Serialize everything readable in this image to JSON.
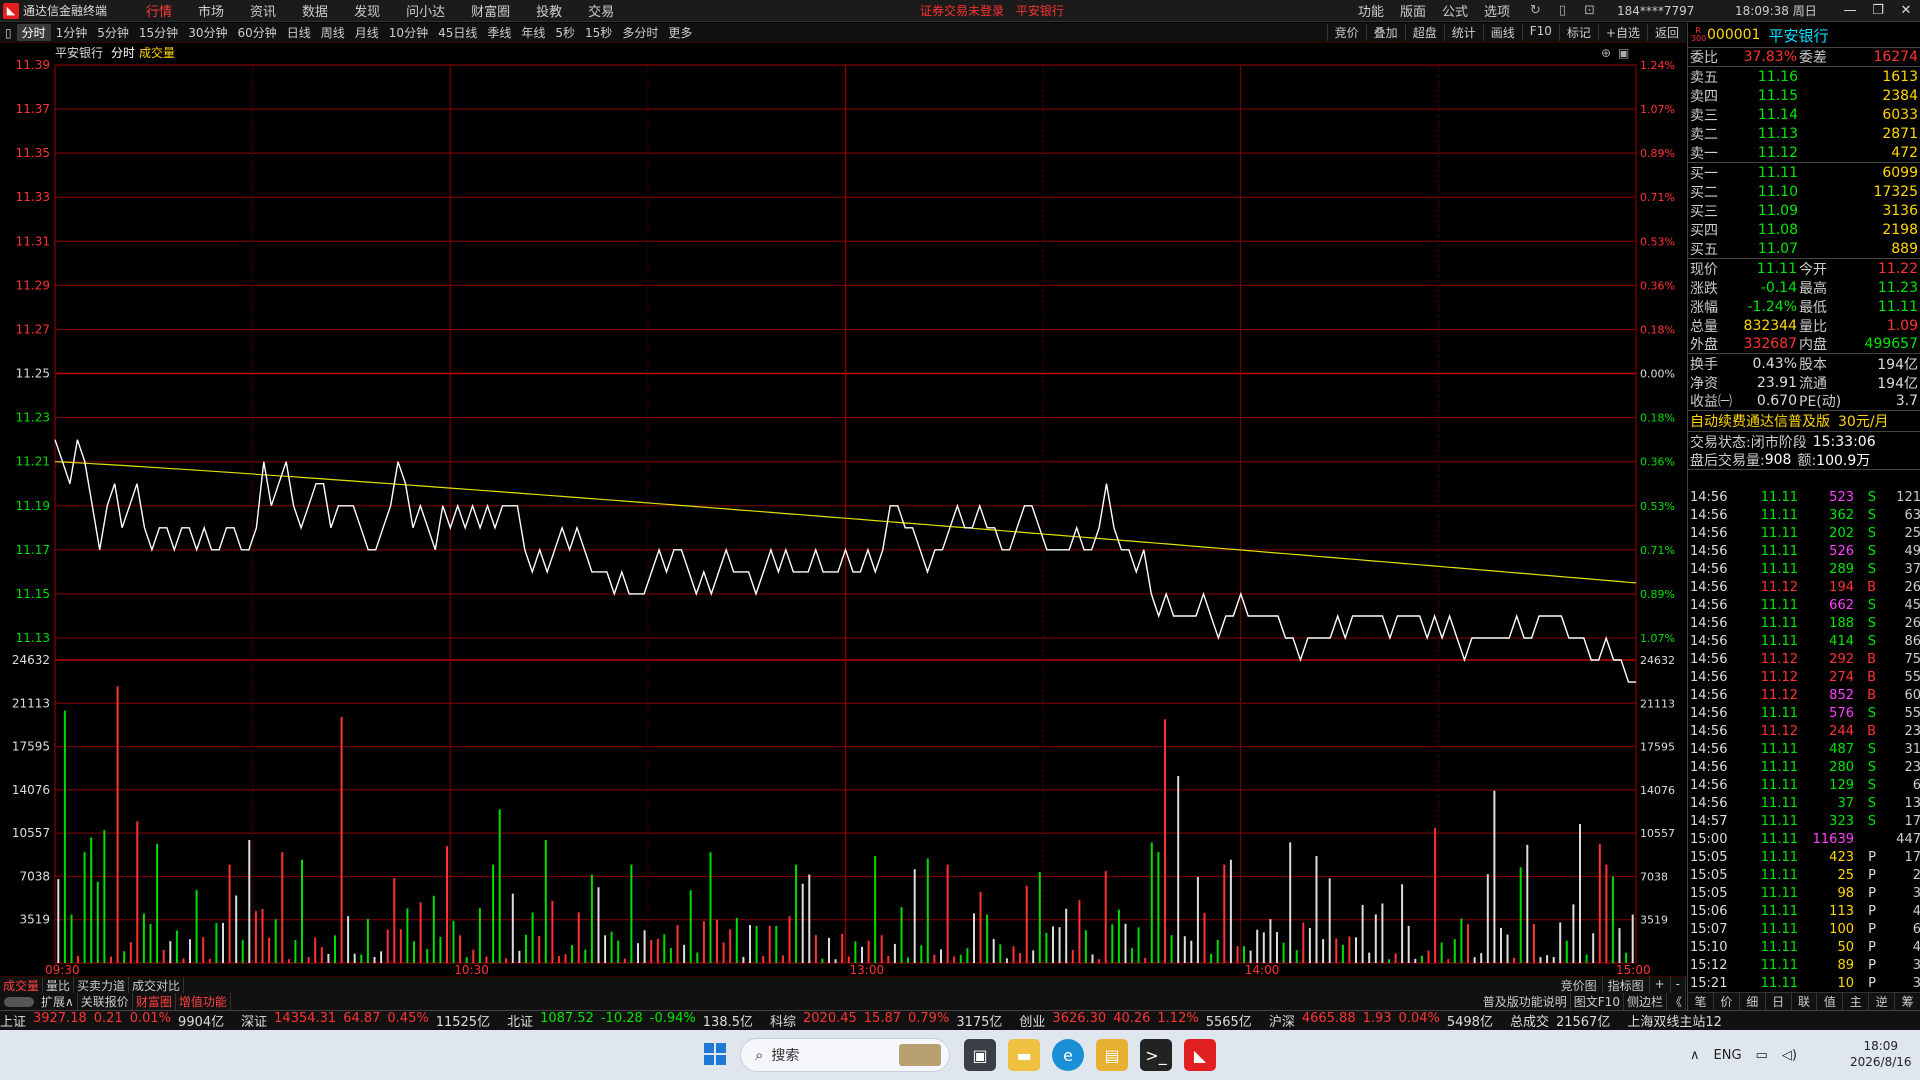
{
  "title_bar": {
    "app_name": "通达信金融终端",
    "menu": [
      "行情",
      "市场",
      "资讯",
      "数据",
      "发现",
      "问小达",
      "财富圈",
      "投教",
      "交易"
    ],
    "active_menu": "行情",
    "notices": [
      "证券交易未登录",
      "平安银行"
    ],
    "right_menu": [
      "功能",
      "版面",
      "公式",
      "选项"
    ],
    "user": "184****7797",
    "clock": "18:09:38 周日"
  },
  "toolbar": {
    "items": [
      "分时",
      "1分钟",
      "5分钟",
      "15分钟",
      "30分钟",
      "60分钟",
      "日线",
      "周线",
      "月线",
      "10分钟",
      "45日线",
      "季线",
      "年线",
      "5秒",
      "15秒",
      "多分时",
      "更多"
    ],
    "active": "分时",
    "right": [
      "竞价",
      "叠加",
      "超盘",
      "统计",
      "画线",
      "F10",
      "标记",
      "+自选",
      "返回"
    ]
  },
  "chart_header": {
    "stock": "平安银行",
    "mode": "分时",
    "indicator": "成交量"
  },
  "chart_data": {
    "type": "line",
    "prev_close": 11.25,
    "price_axis": [
      "11.39",
      "11.37",
      "11.35",
      "11.33",
      "11.31",
      "11.29",
      "11.27",
      "11.25",
      "11.23",
      "11.21",
      "11.19",
      "11.17",
      "11.15",
      "11.13"
    ],
    "pct_axis": [
      "1.24%",
      "1.07%",
      "0.89%",
      "0.71%",
      "0.53%",
      "0.36%",
      "0.18%",
      "0.00%",
      "0.18%",
      "0.36%",
      "0.53%",
      "0.71%",
      "0.89%",
      "1.07%"
    ],
    "vol_axis": [
      "24632",
      "21113",
      "17595",
      "14076",
      "10557",
      "7038",
      "3519"
    ],
    "time_axis": [
      "09:30",
      "10:30",
      "13:00",
      "14:00",
      "15:00"
    ],
    "price": [
      11.22,
      11.21,
      11.2,
      11.22,
      11.21,
      11.19,
      11.17,
      11.19,
      11.2,
      11.18,
      11.19,
      11.2,
      11.18,
      11.17,
      11.18,
      11.18,
      11.17,
      11.18,
      11.18,
      11.17,
      11.18,
      11.17,
      11.17,
      11.18,
      11.18,
      11.17,
      11.17,
      11.18,
      11.21,
      11.19,
      11.2,
      11.21,
      11.19,
      11.18,
      11.19,
      11.2,
      11.2,
      11.18,
      11.19,
      11.19,
      11.19,
      11.18,
      11.17,
      11.17,
      11.18,
      11.19,
      11.21,
      11.2,
      11.18,
      11.19,
      11.18,
      11.17,
      11.19,
      11.18,
      11.19,
      11.18,
      11.19,
      11.18,
      11.19,
      11.18,
      11.19,
      11.19,
      11.19,
      11.17,
      11.16,
      11.17,
      11.16,
      11.17,
      11.18,
      11.17,
      11.18,
      11.17,
      11.16,
      11.16,
      11.16,
      11.15,
      11.16,
      11.15,
      11.15,
      11.15,
      11.16,
      11.17,
      11.16,
      11.17,
      11.17,
      11.16,
      11.15,
      11.16,
      11.15,
      11.16,
      11.17,
      11.16,
      11.16,
      11.16,
      11.15,
      11.16,
      11.17,
      11.16,
      11.17,
      11.16,
      11.16,
      11.16,
      11.17,
      11.16,
      11.16,
      11.16,
      11.17,
      11.16,
      11.16,
      11.17,
      11.16,
      11.17,
      11.19,
      11.19,
      11.18,
      11.18,
      11.17,
      11.16,
      11.17,
      11.17,
      11.18,
      11.19,
      11.18,
      11.18,
      11.19,
      11.18,
      11.18,
      11.17,
      11.17,
      11.18,
      11.19,
      11.19,
      11.18,
      11.17,
      11.17,
      11.17,
      11.17,
      11.18,
      11.17,
      11.17,
      11.18,
      11.2,
      11.18,
      11.17,
      11.17,
      11.16,
      11.17,
      11.15,
      11.14,
      11.15,
      11.14,
      11.14,
      11.14,
      11.14,
      11.15,
      11.14,
      11.13,
      11.14,
      11.14,
      11.15,
      11.14,
      11.14,
      11.14,
      11.14,
      11.14,
      11.13,
      11.13,
      11.12,
      11.13,
      11.13,
      11.13,
      11.13,
      11.14,
      11.13,
      11.14,
      11.14,
      11.14,
      11.14,
      11.14,
      11.13,
      11.14,
      11.14,
      11.14,
      11.14,
      11.13,
      11.14,
      11.13,
      11.14,
      11.13,
      11.12,
      11.13,
      11.13,
      11.13,
      11.13,
      11.13,
      11.13,
      11.14,
      11.13,
      11.13,
      11.14,
      11.14,
      11.14,
      11.14,
      11.13,
      11.13,
      11.13,
      11.12,
      11.12,
      11.13,
      11.12,
      11.12,
      11.11,
      11.11
    ],
    "avg_start": 11.21,
    "avg_end": 11.155
  },
  "volume_seed": 42,
  "bottom_tabs": [
    "成交量",
    "量比",
    "买卖力道",
    "成交对比"
  ],
  "bottom_right": [
    "竞价图",
    "指标图",
    "+",
    "-"
  ],
  "bottom2": [
    "扩展∧",
    "关联报价",
    "财富圈",
    "增值功能"
  ],
  "bottom2_right": [
    "普及版功能说明",
    "图文F10",
    "侧边栏"
  ],
  "quote": {
    "code": "000001",
    "name": "平安银行",
    "weibi_label": "委比",
    "weibi": "37.83%",
    "weicha_label": "委差",
    "weicha": "16274",
    "asks": [
      {
        "l": "卖五",
        "p": "11.16",
        "q": "1613"
      },
      {
        "l": "卖四",
        "p": "11.15",
        "q": "2384"
      },
      {
        "l": "卖三",
        "p": "11.14",
        "q": "6033"
      },
      {
        "l": "卖二",
        "p": "11.13",
        "q": "2871"
      },
      {
        "l": "卖一",
        "p": "11.12",
        "q": "472"
      }
    ],
    "bids": [
      {
        "l": "买一",
        "p": "11.11",
        "q": "6099"
      },
      {
        "l": "买二",
        "p": "11.10",
        "q": "17325"
      },
      {
        "l": "买三",
        "p": "11.09",
        "q": "3136"
      },
      {
        "l": "买四",
        "p": "11.08",
        "q": "2198"
      },
      {
        "l": "买五",
        "p": "11.07",
        "q": "889"
      }
    ],
    "stats": [
      {
        "l": "现价",
        "v": "11.11",
        "vc": "g",
        "l2": "今开",
        "v2": "11.22",
        "v2c": "r"
      },
      {
        "l": "涨跌",
        "v": "-0.14",
        "vc": "g",
        "l2": "最高",
        "v2": "11.23",
        "v2c": "g"
      },
      {
        "l": "涨幅",
        "v": "-1.24%",
        "vc": "g",
        "l2": "最低",
        "v2": "11.11",
        "v2c": "g"
      },
      {
        "l": "总量",
        "v": "832344",
        "vc": "y",
        "l2": "量比",
        "v2": "1.09",
        "v2c": "r"
      },
      {
        "l": "外盘",
        "v": "332687",
        "vc": "r",
        "l2": "内盘",
        "v2": "499657",
        "v2c": "g"
      },
      {
        "l": "换手",
        "v": "0.43%",
        "vc": "w",
        "l2": "股本",
        "v2": "194亿",
        "v2c": "w"
      },
      {
        "l": "净资",
        "v": "23.91",
        "vc": "w",
        "l2": "流通",
        "v2": "194亿",
        "v2c": "w"
      },
      {
        "l": "收益㈠",
        "v": "0.670",
        "vc": "w",
        "l2": "PE(动)",
        "v2": "3.7",
        "v2c": "w"
      }
    ],
    "ad": "自动续费通达信普及版",
    "ad_price": "30元/月",
    "trade_state_label": "交易状态:",
    "trade_state": "闭市阶段",
    "trade_time": "15:33:06",
    "after_label": "盘后交易量:",
    "after_vol": "908",
    "after_amt_label": "额:",
    "after_amt": "100.9万"
  },
  "ticks": [
    [
      "14:56",
      "11.11",
      "523",
      "S",
      "121"
    ],
    [
      "14:56",
      "11.11",
      "362",
      "S",
      "63"
    ],
    [
      "14:56",
      "11.11",
      "202",
      "S",
      "25"
    ],
    [
      "14:56",
      "11.11",
      "526",
      "S",
      "49"
    ],
    [
      "14:56",
      "11.11",
      "289",
      "S",
      "37"
    ],
    [
      "14:56",
      "11.12",
      "194",
      "B",
      "26"
    ],
    [
      "14:56",
      "11.11",
      "662",
      "S",
      "45"
    ],
    [
      "14:56",
      "11.11",
      "188",
      "S",
      "26"
    ],
    [
      "14:56",
      "11.11",
      "414",
      "S",
      "86"
    ],
    [
      "14:56",
      "11.12",
      "292",
      "B",
      "75"
    ],
    [
      "14:56",
      "11.12",
      "274",
      "B",
      "55"
    ],
    [
      "14:56",
      "11.12",
      "852",
      "B",
      "60"
    ],
    [
      "14:56",
      "11.11",
      "576",
      "S",
      "55"
    ],
    [
      "14:56",
      "11.12",
      "244",
      "B",
      "23"
    ],
    [
      "14:56",
      "11.11",
      "487",
      "S",
      "31"
    ],
    [
      "14:56",
      "11.11",
      "280",
      "S",
      "23"
    ],
    [
      "14:56",
      "11.11",
      "129",
      "S",
      "6"
    ],
    [
      "14:56",
      "11.11",
      "37",
      "S",
      "13"
    ],
    [
      "14:57",
      "11.11",
      "323",
      "S",
      "17"
    ],
    [
      "15:00",
      "11.11",
      "11639",
      "",
      "447"
    ],
    [
      "15:05",
      "11.11",
      "423",
      "P",
      "17"
    ],
    [
      "15:05",
      "11.11",
      "25",
      "P",
      "2"
    ],
    [
      "15:05",
      "11.11",
      "98",
      "P",
      "3"
    ],
    [
      "15:06",
      "11.11",
      "113",
      "P",
      "4"
    ],
    [
      "15:07",
      "11.11",
      "100",
      "P",
      "6"
    ],
    [
      "15:10",
      "11.11",
      "50",
      "P",
      "4"
    ],
    [
      "15:12",
      "11.11",
      "89",
      "P",
      "3"
    ],
    [
      "15:21",
      "11.11",
      "10",
      "P",
      "3"
    ]
  ],
  "rp_foot": [
    "笔",
    "价",
    "细",
    "日",
    "联",
    "值",
    "主",
    "逆",
    "筹"
  ],
  "status_bar": [
    {
      "n": "上证",
      "v": "3927.18",
      "c": "0.21",
      "p": "0.01%",
      "a": "9904亿",
      "col": "r"
    },
    {
      "n": "深证",
      "v": "14354.31",
      "c": "64.87",
      "p": "0.45%",
      "a": "11525亿",
      "col": "r"
    },
    {
      "n": "北证",
      "v": "1087.52",
      "c": "-10.28",
      "p": "-0.94%",
      "a": "138.5亿",
      "col": "g"
    },
    {
      "n": "科综",
      "v": "2020.45",
      "c": "15.87",
      "p": "0.79%",
      "a": "3175亿",
      "col": "r"
    },
    {
      "n": "创业",
      "v": "3626.30",
      "c": "40.26",
      "p": "1.12%",
      "a": "5565亿",
      "col": "r"
    },
    {
      "n": "沪深",
      "v": "4665.88",
      "c": "1.93",
      "p": "0.04%",
      "a": "5498亿",
      "col": "r"
    }
  ],
  "status_total_label": "总成交",
  "status_total": "21567亿",
  "status_server": "上海双线主站12",
  "taskbar": {
    "search": "搜索",
    "lang": "ENG",
    "time": "18:09",
    "date": "2026/8/16"
  }
}
